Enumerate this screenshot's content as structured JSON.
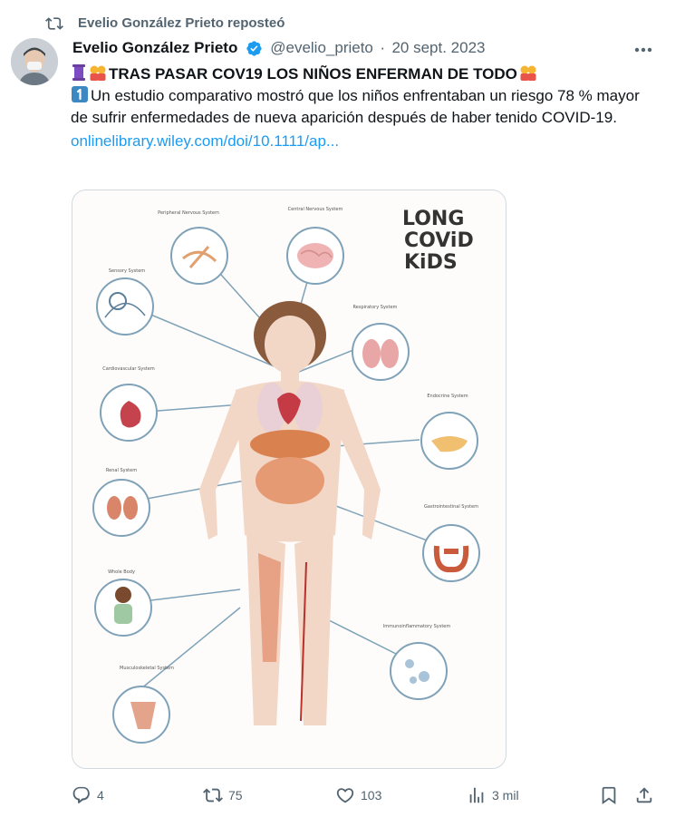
{
  "repost": {
    "text": "Evelio González Prieto reposteó"
  },
  "tweet": {
    "author_name": "Evelio González Prieto",
    "handle": "@evelio_prieto",
    "separator": "·",
    "date": "20 sept. 2023",
    "headline": "TRAS PASAR COV19 LOS NIÑOS ENFERMAN DE TODO",
    "body": "Un estudio comparativo mostró que los niños enfrentaban un riesgo 78 % mayor de sufrir enfermedades de nueva aparición después de haber tenido COVID-19.",
    "link": "onlinelibrary.wiley.com/doi/10.1111/ap..."
  },
  "image": {
    "logo_lines": [
      "LONG",
      "COViD",
      "KiDS"
    ],
    "systems": [
      {
        "label": "Peripheral Nervous System",
        "icon": "nerve-icon"
      },
      {
        "label": "Central Nervous System",
        "icon": "brain-icon"
      },
      {
        "label": "Sensory System",
        "icon": "eye-icon"
      },
      {
        "label": "Respiratory System",
        "icon": "lungs-icon"
      },
      {
        "label": "Cardiovascular System",
        "icon": "heart-icon"
      },
      {
        "label": "Endocrine System",
        "icon": "pancreas-icon"
      },
      {
        "label": "Renal System",
        "icon": "kidney-icon"
      },
      {
        "label": "Gastrointestinal System",
        "icon": "intestine-icon"
      },
      {
        "label": "Whole Body",
        "icon": "child-icon"
      },
      {
        "label": "Immunoinflammatory System",
        "icon": "cells-icon"
      },
      {
        "label": "Musculoskeletal System",
        "icon": "muscle-icon"
      }
    ]
  },
  "actions": {
    "replies": "4",
    "reposts": "75",
    "likes": "103",
    "views": "3 mil"
  },
  "colors": {
    "text_primary": "#0f1419",
    "text_secondary": "#536471",
    "link": "#1d9bf0",
    "verified_badge": "#1d9bf0",
    "border": "#cfd9de"
  }
}
